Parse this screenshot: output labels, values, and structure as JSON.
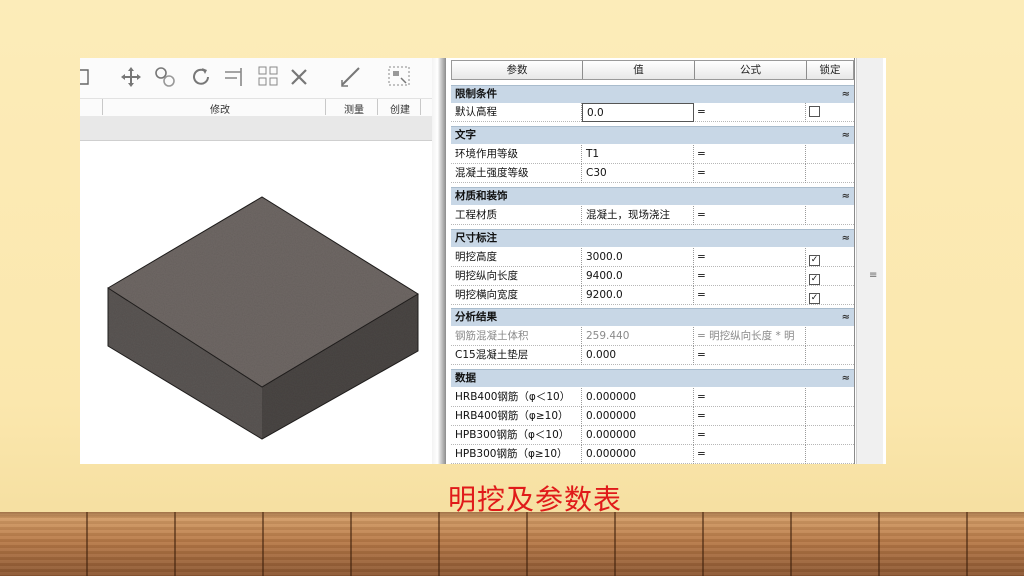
{
  "ribbon": {
    "group_labels": [
      "修改",
      "测量",
      "创建"
    ]
  },
  "properties": {
    "headers": {
      "param": "参数",
      "value": "值",
      "formula": "公式",
      "lock": "锁定"
    },
    "sections": [
      {
        "title": "限制条件",
        "rows": [
          {
            "name": "默认高程",
            "value": "0.0",
            "formula": "=",
            "lock": "unchecked"
          }
        ]
      },
      {
        "title": "文字",
        "rows": [
          {
            "name": "环境作用等级",
            "value": "T1",
            "formula": "=",
            "lock": ""
          },
          {
            "name": "混凝土强度等级",
            "value": "C30",
            "formula": "=",
            "lock": ""
          }
        ]
      },
      {
        "title": "材质和装饰",
        "rows": [
          {
            "name": "工程材质",
            "value": "混凝土，现场浇注",
            "formula": "=",
            "lock": ""
          }
        ]
      },
      {
        "title": "尺寸标注",
        "rows": [
          {
            "name": "明挖高度",
            "value": "3000.0",
            "formula": "=",
            "lock": "checked"
          },
          {
            "name": "明挖纵向长度",
            "value": "9400.0",
            "formula": "=",
            "lock": "checked"
          },
          {
            "name": "明挖横向宽度",
            "value": "9200.0",
            "formula": "=",
            "lock": "checked"
          }
        ]
      },
      {
        "title": "分析结果",
        "rows": [
          {
            "name": "钢筋混凝土体积",
            "value": "259.440",
            "formula": "= 明挖纵向长度 * 明",
            "lock": "",
            "greyed": true
          },
          {
            "name": "C15混凝土垫层",
            "value": "0.000",
            "formula": "=",
            "lock": ""
          }
        ]
      },
      {
        "title": "数据",
        "rows": [
          {
            "name": "HRB400钢筋（φ＜10）",
            "value": "0.000000",
            "formula": "=",
            "lock": ""
          },
          {
            "name": "HRB400钢筋（φ≥10）",
            "value": "0.000000",
            "formula": "=",
            "lock": ""
          },
          {
            "name": "HPB300钢筋（φ＜10）",
            "value": "0.000000",
            "formula": "=",
            "lock": ""
          },
          {
            "name": "HPB300钢筋（φ≥10）",
            "value": "0.000000",
            "formula": "=",
            "lock": ""
          }
        ]
      }
    ],
    "section_toggle": "≈"
  },
  "caption": "明挖及参数表",
  "colors": {
    "caption": "#e01a1a",
    "section_header": "#c8d7e6",
    "block_top": "#6f6865",
    "block_left": "#5b5654",
    "block_right": "#4a4644"
  }
}
